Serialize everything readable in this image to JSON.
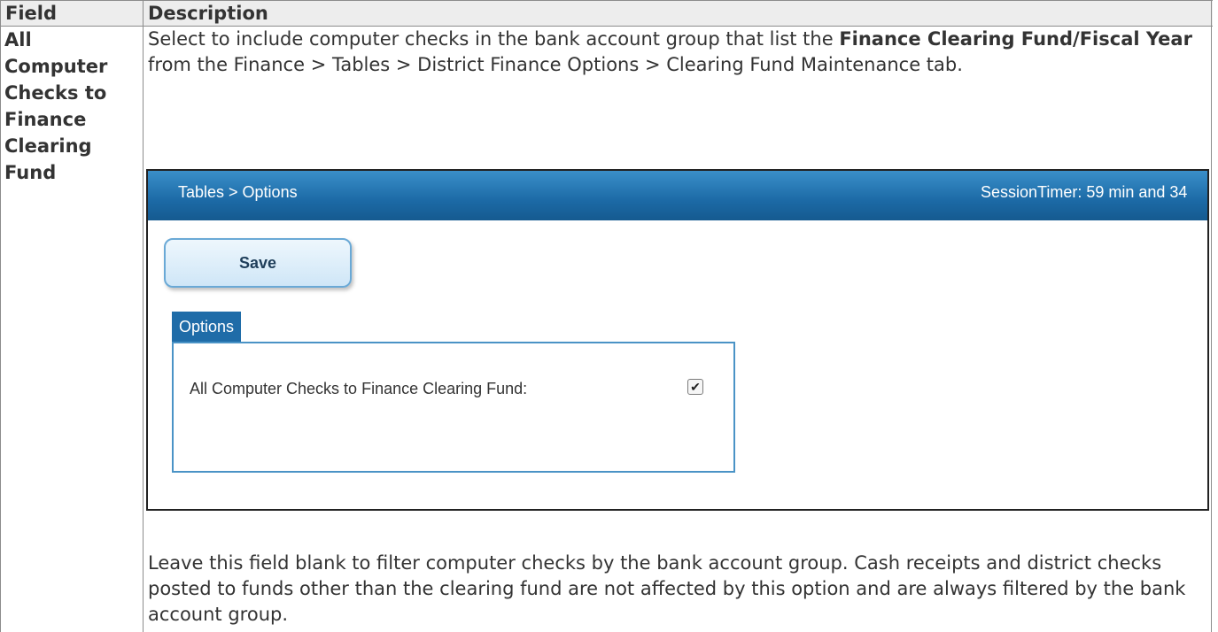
{
  "table": {
    "header_field": "Field",
    "header_description": "Description"
  },
  "row": {
    "field_name": "All Computer Checks to Finance Clearing Fund",
    "description_top": {
      "part1": "Select to include computer checks in the bank account group that list the ",
      "bold": "Finance Clearing Fund/Fiscal Year",
      "part2": " from the Finance > Tables > District Finance Options > Clearing Fund Maintenance tab."
    },
    "description_bottom": "Leave this field blank to filter computer checks by the bank account group. Cash receipts and district checks posted to funds other than the clearing fund are not affected by this option and are always filtered by the bank account group."
  },
  "screenshot": {
    "breadcrumb": "Tables > Options",
    "session_timer": "SessionTimer: 59 min and 34",
    "save_label": "Save",
    "tab_label": "Options",
    "option_label": "All Computer Checks to Finance Clearing Fund:",
    "option_checked": true,
    "check_glyph": "✔"
  },
  "colors": {
    "header_bg": "#ededed",
    "border": "#8c8c8c",
    "bar_blue": "#1c6aa6",
    "tab_blue": "#1f6ca8"
  }
}
